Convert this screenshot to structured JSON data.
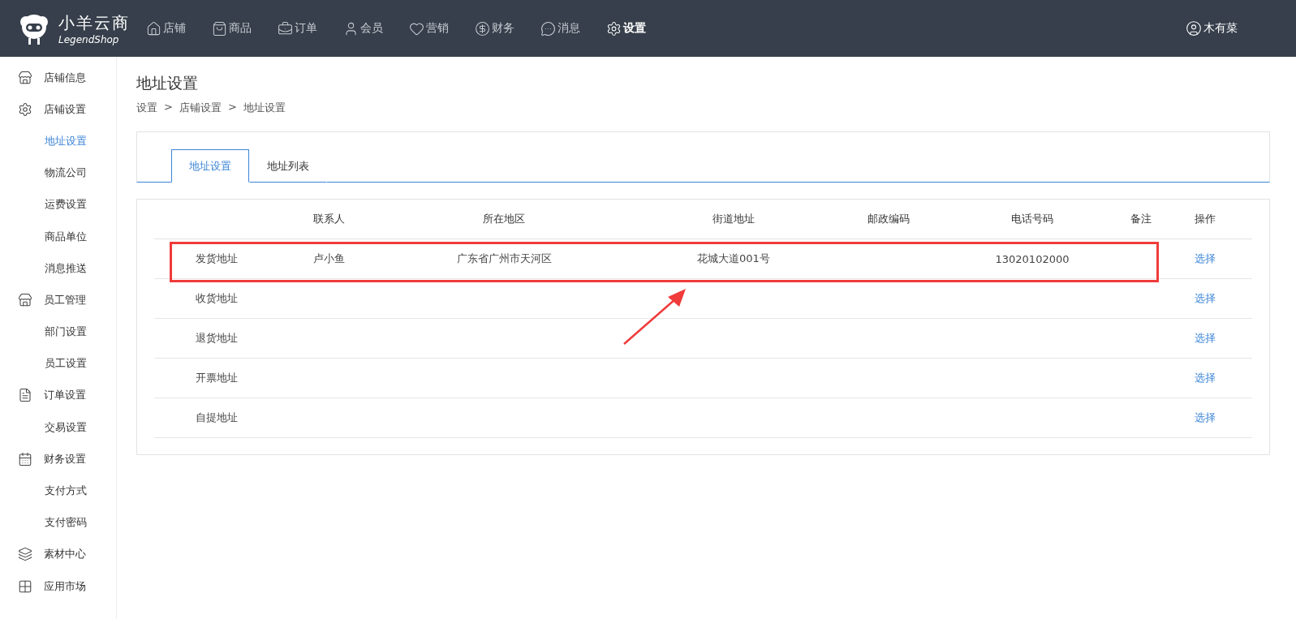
{
  "brand": {
    "name": "小羊云商",
    "sub": "LegendShop"
  },
  "nav": [
    {
      "label": "店铺",
      "selected": false
    },
    {
      "label": "商品",
      "selected": false
    },
    {
      "label": "订单",
      "selected": false
    },
    {
      "label": "会员",
      "selected": false
    },
    {
      "label": "营销",
      "selected": false
    },
    {
      "label": "财务",
      "selected": false
    },
    {
      "label": "消息",
      "selected": false
    },
    {
      "label": "设置",
      "selected": true
    }
  ],
  "user": {
    "name": "木有菜"
  },
  "sidebar": {
    "items": [
      {
        "label": "店铺信息",
        "selected": false
      },
      {
        "label": "店铺设置",
        "selected": false,
        "children": [
          {
            "label": "地址设置",
            "selected": true
          },
          {
            "label": "物流公司",
            "selected": false
          },
          {
            "label": "运费设置",
            "selected": false
          },
          {
            "label": "商品单位",
            "selected": false
          },
          {
            "label": "消息推送",
            "selected": false
          }
        ]
      },
      {
        "label": "员工管理",
        "selected": false,
        "children": [
          {
            "label": "部门设置",
            "selected": false
          },
          {
            "label": "员工设置",
            "selected": false
          }
        ]
      },
      {
        "label": "订单设置",
        "selected": false,
        "children": [
          {
            "label": "交易设置",
            "selected": false
          }
        ]
      },
      {
        "label": "财务设置",
        "selected": false,
        "children": [
          {
            "label": "支付方式",
            "selected": false
          },
          {
            "label": "支付密码",
            "selected": false
          }
        ]
      },
      {
        "label": "素材中心",
        "selected": false
      },
      {
        "label": "应用市场",
        "selected": false
      }
    ]
  },
  "page": {
    "title": "地址设置",
    "breadcrumb": [
      "设置",
      "店铺设置",
      "地址设置"
    ],
    "separator": ">"
  },
  "tabs": [
    {
      "label": "地址设置",
      "selected": true
    },
    {
      "label": "地址列表",
      "selected": false
    }
  ],
  "table": {
    "columns": [
      "",
      "联系人",
      "所在地区",
      "街道地址",
      "邮政编码",
      "电话号码",
      "备注",
      "操作"
    ],
    "rows": [
      {
        "cells": [
          "发货地址",
          "卢小鱼",
          "广东省广州市天河区",
          "花城大道001号",
          "",
          "13020102000",
          ""
        ],
        "action": "选择",
        "highlighted": true
      },
      {
        "cells": [
          "收货地址",
          "",
          "",
          "",
          "",
          "",
          ""
        ],
        "action": "选择",
        "highlighted": false
      },
      {
        "cells": [
          "退货地址",
          "",
          "",
          "",
          "",
          "",
          ""
        ],
        "action": "选择",
        "highlighted": false
      },
      {
        "cells": [
          "开票地址",
          "",
          "",
          "",
          "",
          "",
          ""
        ],
        "action": "选择",
        "highlighted": false
      },
      {
        "cells": [
          "自提地址",
          "",
          "",
          "",
          "",
          "",
          ""
        ],
        "action": "选择",
        "highlighted": false
      }
    ]
  }
}
